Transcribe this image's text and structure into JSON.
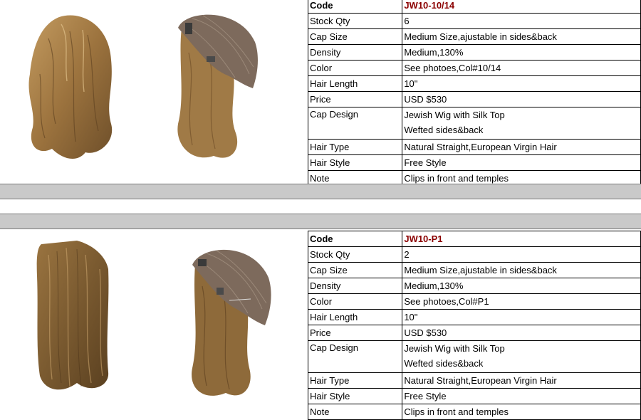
{
  "products": [
    {
      "code_label": "Code",
      "code_value": "JW10-10/14",
      "rows": [
        {
          "label": "Stock Qty",
          "value": "6"
        },
        {
          "label": "Cap Size",
          "value": "Medium Size,ajustable in sides&back"
        },
        {
          "label": "Density",
          "value": "Medium,130%"
        },
        {
          "label": "Color",
          "value": "See photoes,Col#10/14"
        },
        {
          "label": "Hair Length",
          "value": "10\""
        },
        {
          "label": "Price",
          "value": " USD $530"
        }
      ],
      "cap_design_label": "Cap Design",
      "cap_design_lines": [
        "Jewish Wig with Silk Top",
        "Wefted sides&back"
      ],
      "rows_after": [
        {
          "label": "Hair Type",
          "value": "Natural Straight,European Virgin Hair"
        },
        {
          "label": "Hair Style",
          "value": "Free Style"
        },
        {
          "label": "Note",
          "value": "Clips in front and temples"
        }
      ],
      "images": [
        "wig-front-photo",
        "wig-cap-inside-photo"
      ]
    },
    {
      "code_label": "Code",
      "code_value": "JW10-P1",
      "rows": [
        {
          "label": "Stock Qty",
          "value": "2"
        },
        {
          "label": "Cap Size",
          "value": "Medium Size,ajustable in sides&back"
        },
        {
          "label": "Density",
          "value": "Medium,130%"
        },
        {
          "label": "Color",
          "value": "See photoes,Col#P1"
        },
        {
          "label": "Hair Length",
          "value": "10\""
        },
        {
          "label": "Price",
          "value": " USD $530"
        }
      ],
      "cap_design_label": "Cap Design",
      "cap_design_lines": [
        "Jewish Wig with Silk Top",
        "Wefted sides&back"
      ],
      "rows_after": [
        {
          "label": "Hair Type",
          "value": "Natural Straight,European Virgin Hair"
        },
        {
          "label": "Hair Style",
          "value": "Free Style"
        },
        {
          "label": "Note",
          "value": "Clips in front and temples"
        }
      ],
      "images": [
        "wig-front-photo",
        "wig-cap-inside-photo"
      ]
    }
  ],
  "colors": {
    "code_text": "#8b0000",
    "separator_band": "#c9c9c9",
    "hair_light": "#b08850",
    "hair_dark": "#7a5a30",
    "cap": "#7d6a5c"
  }
}
